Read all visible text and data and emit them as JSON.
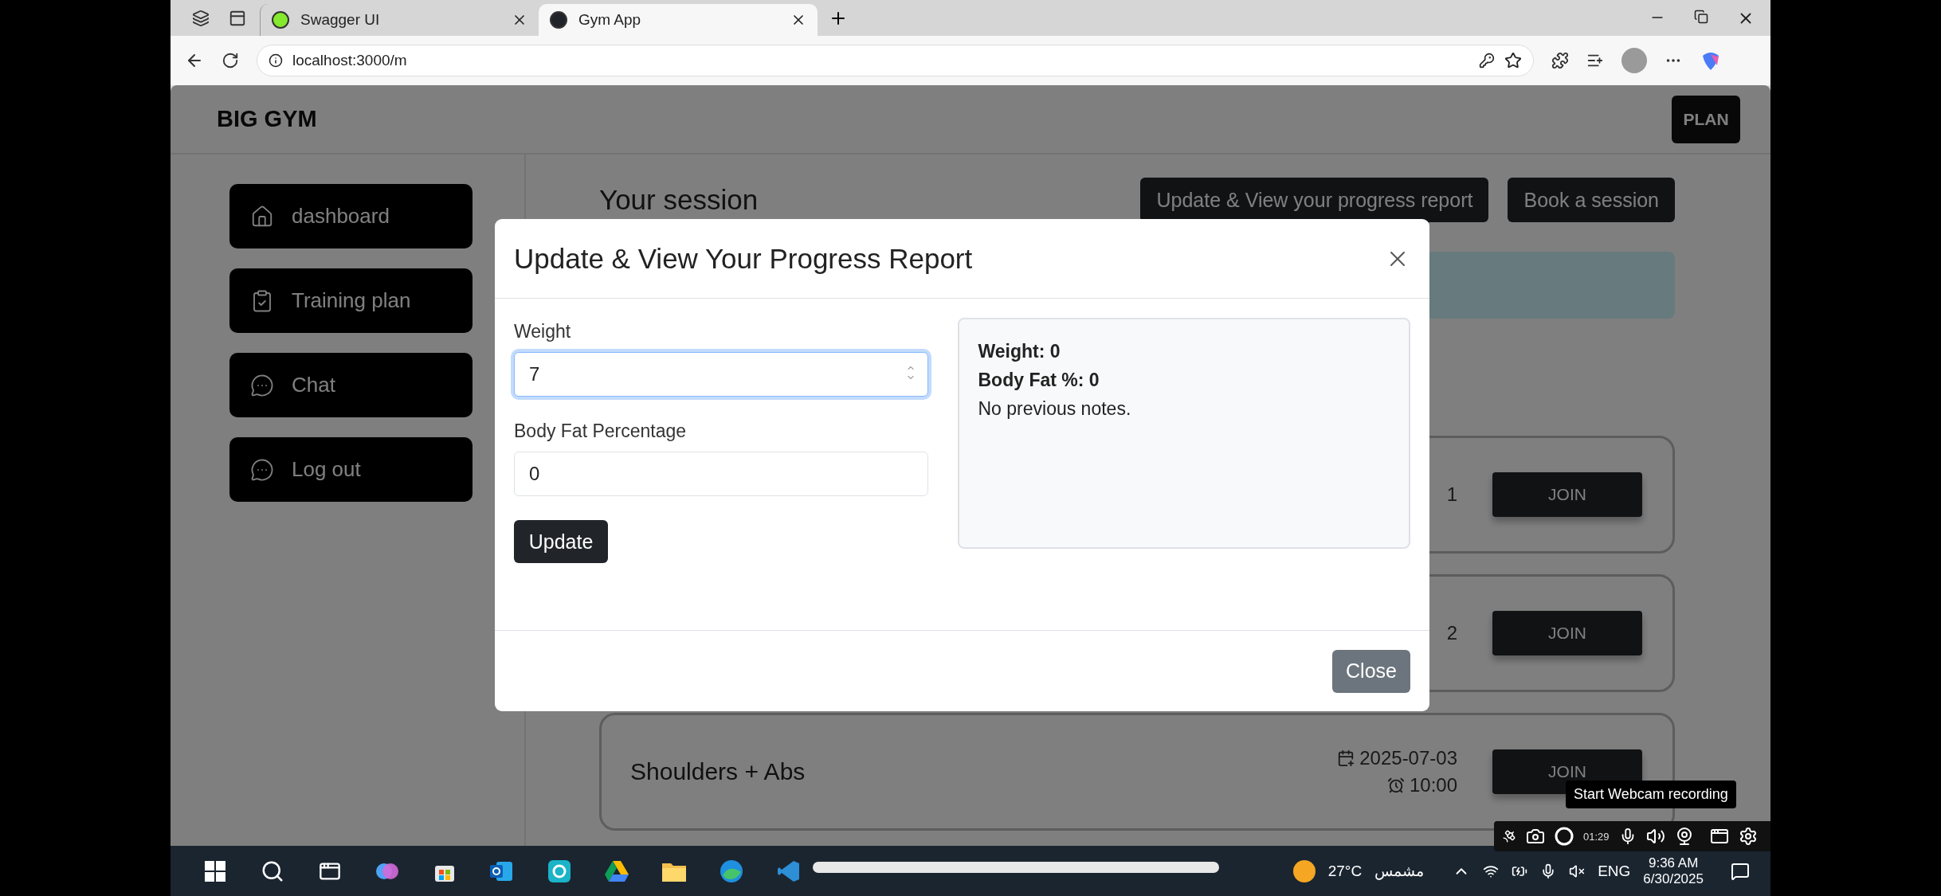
{
  "browser": {
    "tabs": [
      {
        "title": "Swagger UI",
        "selected": false
      },
      {
        "title": "Gym App",
        "selected": true
      }
    ],
    "address": "localhost:3000/m"
  },
  "header": {
    "brand": "BIG GYM",
    "plan_button": "PLAN"
  },
  "sidebar": {
    "items": [
      {
        "label": "dashboard"
      },
      {
        "label": "Training plan"
      },
      {
        "label": "Chat"
      },
      {
        "label": "Log out"
      }
    ]
  },
  "main": {
    "title": "Your session",
    "buttons": [
      "Update & View your progress report",
      "Book a session"
    ],
    "sessions": [
      {
        "date": "1",
        "join": "JOIN"
      },
      {
        "date": "2",
        "join": "JOIN"
      },
      {
        "name": "Shoulders + Abs",
        "date": "2025-07-03",
        "time": "10:00",
        "join": "JOIN"
      }
    ]
  },
  "modal": {
    "title": "Update & View Your Progress Report",
    "fields": [
      {
        "label": "Weight",
        "value": "7",
        "focused": true
      },
      {
        "label": "Body Fat Percentage",
        "value": "0",
        "focused": false
      }
    ],
    "submit": "Update",
    "summary": [
      {
        "text": "Weight: 0",
        "bold": true
      },
      {
        "text": "Body Fat %: 0",
        "bold": true
      },
      {
        "text": "No previous notes.",
        "bold": false
      }
    ],
    "close_button": "Close"
  },
  "recorder": {
    "timer": "01:29",
    "tooltip": "Start Webcam recording"
  },
  "taskbar": {
    "temperature": "27°C",
    "weather": "مشمس",
    "language": "ENG",
    "time": "9:36 AM",
    "date": "6/30/2025"
  }
}
